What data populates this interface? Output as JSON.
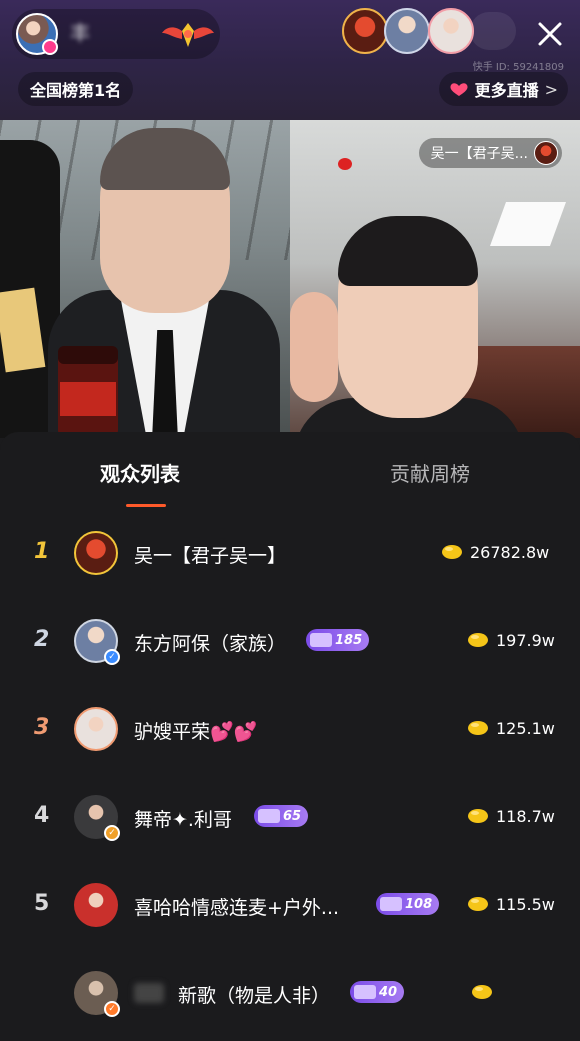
{
  "header": {
    "host_name": "丰",
    "room_id": "快手 ID: 59241809",
    "rank_text": "全国榜第1名",
    "more_live_label": "更多直播",
    "more_live_chevron": ">",
    "close_icon": "close-icon"
  },
  "video": {
    "right_tag_text": "吴一【君子吴..."
  },
  "tabs": {
    "active": "观众列表",
    "inactive": "贡献周榜"
  },
  "audience": [
    {
      "rank": "1",
      "name": "吴一【君子吴一】",
      "level": "",
      "score": "26782.8w"
    },
    {
      "rank": "2",
      "name": "东方阿保（家族）",
      "level": "185",
      "score": "197.9w"
    },
    {
      "rank": "3",
      "name": "驴嫂平荣💕💕",
      "level": "",
      "score": "125.1w"
    },
    {
      "rank": "4",
      "name": "舞帝✦.利哥",
      "level": "65",
      "score": "118.7w"
    },
    {
      "rank": "5",
      "name": "喜哈哈情感连麦+户外...",
      "level": "108",
      "score": "115.5w"
    },
    {
      "rank": "",
      "name": "新歌（物是人非）",
      "level": "40",
      "score": ""
    }
  ],
  "colors": {
    "header_bg": "#2e2446",
    "panel_bg": "#1b1b1d",
    "tab_underline": "#ff5a2a",
    "rank_gold": "#f2c53a",
    "level_badge": "#7b4ce8",
    "coin": "#f5c518"
  },
  "icons": [
    "close-icon",
    "crown-wing-icon",
    "more-live-icon",
    "coin-icon",
    "level-badge-icon",
    "verified-icon"
  ]
}
